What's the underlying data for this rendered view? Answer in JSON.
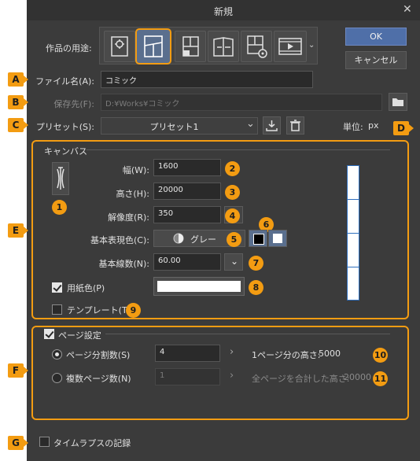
{
  "dialog": {
    "title": "新規",
    "ok_label": "OK",
    "cancel_label": "キャンセル"
  },
  "usage": {
    "label": "作品の用途:"
  },
  "markers": {
    "a": "A",
    "b": "B",
    "c": "C",
    "d": "D",
    "e": "E",
    "f": "F",
    "g": "G"
  },
  "numbers": [
    "1",
    "2",
    "3",
    "4",
    "5",
    "6",
    "7",
    "8",
    "9",
    "10",
    "11"
  ],
  "file": {
    "name_label": "ファイル名(A):",
    "name_value": "コミック",
    "save_label": "保存先(F):",
    "save_value": "D:¥Works¥コミック"
  },
  "preset": {
    "label": "プリセット(S):",
    "value": "プリセット1",
    "unit_label": "単位:",
    "unit_value": "px"
  },
  "canvas": {
    "section_title": "キャンバス",
    "width_label": "幅(W):",
    "width_value": "1600",
    "height_label": "高さ(H):",
    "height_value": "20000",
    "resolution_label": "解像度(R):",
    "resolution_value": "350",
    "basic_color_label": "基本表現色(C):",
    "basic_color_value": "グレー",
    "line_count_label": "基本線数(N):",
    "line_count_value": "60.00",
    "paper_color_label": "用紙色(P)",
    "template_label": "テンプレート(T)"
  },
  "page_settings": {
    "label": "ページ設定",
    "split_label": "ページ分割数(S)",
    "split_value": "4",
    "per_page_height_label": "1ページ分の高さ:",
    "per_page_height_value": "5000",
    "multi_label": "複数ページ数(N)",
    "multi_value": "1",
    "total_height_label": "全ページを合計した高さ:",
    "total_height_value": "20000"
  },
  "timelapse": {
    "label": "タイムラプスの記録"
  },
  "colors": {
    "dialog_bg": "#3b3b3b",
    "accent": "#f39c12",
    "ok_button": "#4f6fa8"
  }
}
